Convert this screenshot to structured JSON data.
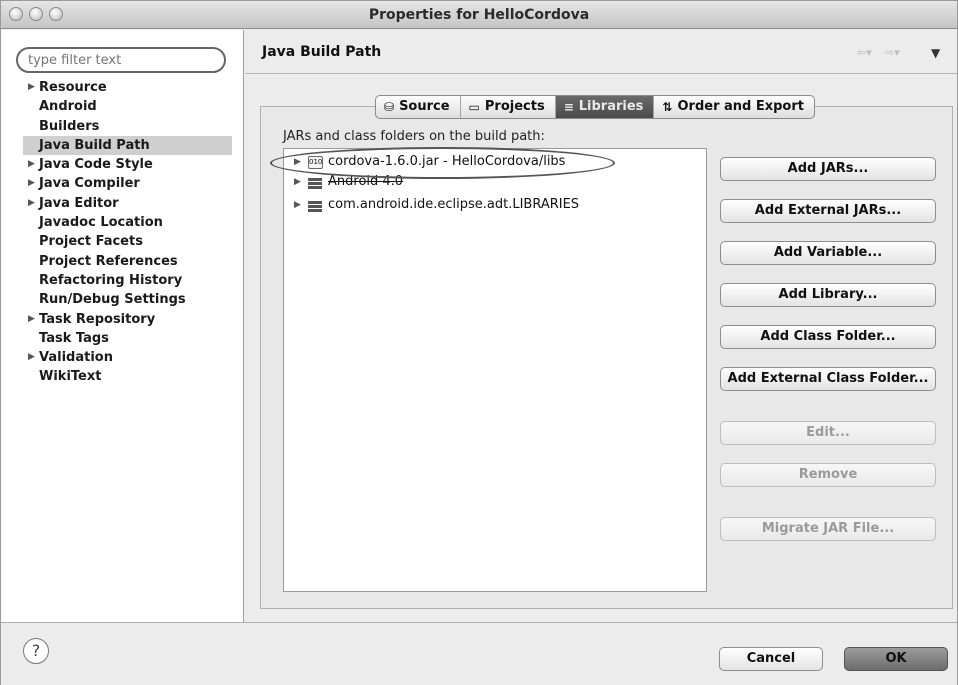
{
  "window": {
    "title": "Properties for HelloCordova"
  },
  "filter": {
    "placeholder": "type filter text"
  },
  "sidebar": {
    "items": [
      {
        "label": "Resource",
        "expandable": true
      },
      {
        "label": "Android",
        "expandable": false
      },
      {
        "label": "Builders",
        "expandable": false
      },
      {
        "label": "Java Build Path",
        "expandable": false,
        "selected": true
      },
      {
        "label": "Java Code Style",
        "expandable": true
      },
      {
        "label": "Java Compiler",
        "expandable": true
      },
      {
        "label": "Java Editor",
        "expandable": true
      },
      {
        "label": "Javadoc Location",
        "expandable": false
      },
      {
        "label": "Project Facets",
        "expandable": false
      },
      {
        "label": "Project References",
        "expandable": false
      },
      {
        "label": "Refactoring History",
        "expandable": false
      },
      {
        "label": "Run/Debug Settings",
        "expandable": false
      },
      {
        "label": "Task Repository",
        "expandable": true
      },
      {
        "label": "Task Tags",
        "expandable": false
      },
      {
        "label": "Validation",
        "expandable": true
      },
      {
        "label": "WikiText",
        "expandable": false
      }
    ]
  },
  "page": {
    "title": "Java Build Path"
  },
  "tabs": [
    {
      "label": "Source",
      "icon": "source-folder-icon",
      "active": false
    },
    {
      "label": "Projects",
      "icon": "projects-folder-icon",
      "active": false
    },
    {
      "label": "Libraries",
      "icon": "libraries-icon",
      "active": true
    },
    {
      "label": "Order and Export",
      "icon": "order-export-icon",
      "active": false
    }
  ],
  "build_path": {
    "label": "JARs and class folders on the build path:",
    "entries": [
      {
        "label": "cordova-1.6.0.jar - HelloCordova/libs",
        "icon": "jar-icon"
      },
      {
        "label": "Android 4.0",
        "icon": "library-icon"
      },
      {
        "label": "com.android.ide.eclipse.adt.LIBRARIES",
        "icon": "library-icon"
      }
    ]
  },
  "buttons": {
    "add_jars": "Add JARs...",
    "add_external_jars": "Add External JARs...",
    "add_variable": "Add Variable...",
    "add_library": "Add Library...",
    "add_class_folder": "Add Class Folder...",
    "add_external_class_folder": "Add External Class Folder...",
    "edit": "Edit...",
    "remove": "Remove",
    "migrate_jar": "Migrate JAR File..."
  },
  "footer": {
    "help": "?",
    "cancel": "Cancel",
    "ok": "OK"
  },
  "colors": {
    "selected_row": "#cfcfcf",
    "active_tab": "#5a5a5a",
    "window_bg": "#ececec"
  }
}
